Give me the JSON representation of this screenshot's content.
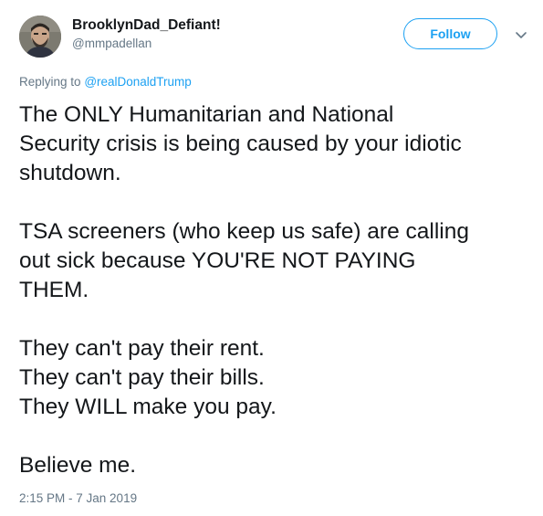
{
  "author": {
    "display_name": "BrooklynDad_Defiant!",
    "handle": "@mmpadellan"
  },
  "follow_button": {
    "label": "Follow",
    "color": "#1da1f2"
  },
  "menu_icon": "chevron-down-icon",
  "reply": {
    "prefix": "Replying to",
    "mention": "@realDonaldTrump"
  },
  "tweet": {
    "paragraphs": [
      {
        "lines": [
          "The ONLY Humanitarian and National",
          "Security crisis is being caused by your idiotic",
          "shutdown."
        ]
      },
      {
        "lines": [
          "TSA screeners (who keep us safe) are calling",
          "out sick because YOU'RE NOT PAYING",
          "THEM."
        ]
      },
      {
        "lines": [
          "They can't pay their rent.",
          "They can't pay their bills.",
          "They WILL make you pay."
        ]
      },
      {
        "lines": [
          "Believe me."
        ]
      }
    ]
  },
  "timestamp": "2:15 PM - 7 Jan 2019",
  "colors": {
    "text": "#14171a",
    "secondary": "#657786",
    "accent": "#1da1f2"
  }
}
